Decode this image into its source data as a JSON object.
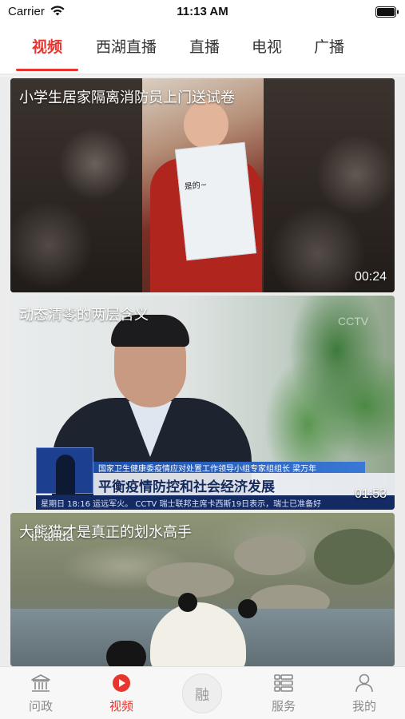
{
  "status_bar": {
    "carrier": "Carrier",
    "time": "11:13 AM",
    "icons": [
      "wifi-icon",
      "battery-icon"
    ]
  },
  "channel_tabs": {
    "active_index": 0,
    "accent_color": "#e8352e",
    "items": [
      {
        "label": "视频"
      },
      {
        "label": "西湖直播"
      },
      {
        "label": "直播"
      },
      {
        "label": "电视"
      },
      {
        "label": "广播"
      }
    ]
  },
  "feed": {
    "videos": [
      {
        "title": "小学生居家隔离消防员上门送试卷",
        "duration": "00:24",
        "frame_text": "是的~"
      },
      {
        "title": "动态清零的两层含义",
        "duration": "01:53",
        "frame_text": {
          "logo": "CCTV",
          "ticker_top": "国家卫生健康委疫情应对处置工作领导小组专家组组长 梁万年",
          "caption": "平衡疫情防控和社会经济发展",
          "bottom_ticker": "星期日 18:16 运远军火。 CCTV 瑞士联邦主席卡西斯19日表示，瑞士已准备好"
        }
      },
      {
        "title": "大熊猫才是真正的划水高手",
        "duration": "",
        "frame_text": "iPanda"
      }
    ]
  },
  "tab_bar": {
    "active_index": 1,
    "items": [
      {
        "label": "问政",
        "icon": "government-building-icon"
      },
      {
        "label": "视频",
        "icon": "play-circle-icon"
      },
      {
        "label": "融",
        "icon": "center-rong-button"
      },
      {
        "label": "服务",
        "icon": "services-list-icon"
      },
      {
        "label": "我的",
        "icon": "user-profile-icon"
      }
    ]
  }
}
